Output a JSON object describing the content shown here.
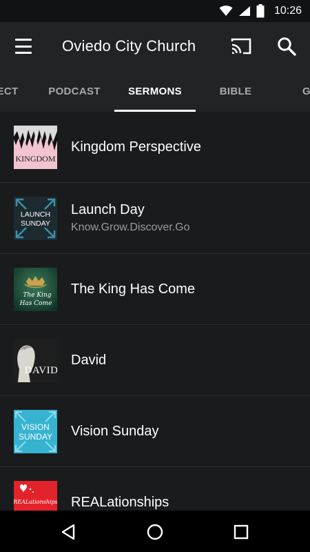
{
  "status_bar": {
    "time": "10:26",
    "icons": [
      "wifi-icon",
      "signal-icon",
      "battery-icon"
    ]
  },
  "app_bar": {
    "title": "Oviedo City Church",
    "menu_icon": "hamburger-menu-icon",
    "cast_icon": "cast-icon",
    "search_icon": "search-icon"
  },
  "tabs": [
    {
      "label": "ECT",
      "active": false
    },
    {
      "label": "PODCAST",
      "active": false
    },
    {
      "label": "SERMONS",
      "active": true
    },
    {
      "label": "BIBLE",
      "active": false
    },
    {
      "label": "G",
      "active": false
    }
  ],
  "sermons": [
    {
      "title": "Kingdom Perspective",
      "subtitle": "",
      "art_text": "KINGDOM"
    },
    {
      "title": "Launch Day",
      "subtitle": "Know.Grow.Discover.Go",
      "art_text": "LAUNCH SUNDAY"
    },
    {
      "title": "The King Has Come",
      "subtitle": "",
      "art_text": "The King Has Come"
    },
    {
      "title": "David",
      "subtitle": "",
      "art_text": "DAVID"
    },
    {
      "title": "Vision Sunday",
      "subtitle": "",
      "art_text": "VISION SUNDAY"
    },
    {
      "title": "REALationships",
      "subtitle": "",
      "art_text": "REALationships"
    }
  ],
  "nav_bar": {
    "icons": [
      "back-icon",
      "home-icon",
      "recents-icon"
    ]
  },
  "colors": {
    "app_bar": "#222325",
    "background": "#1a1b1d",
    "status_bar": "#111214",
    "nav_bar": "#000000"
  }
}
